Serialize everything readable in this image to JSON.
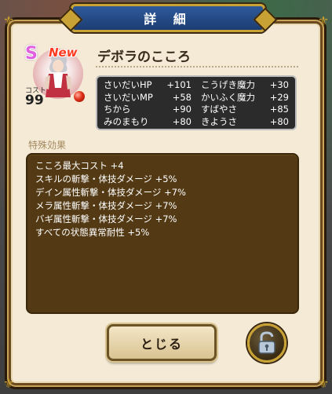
{
  "dialog": {
    "title": "詳 細"
  },
  "monster": {
    "rank": "S",
    "new_badge": "New",
    "cost_label": "コスト",
    "cost_value": "99",
    "heart_name": "デボラのこころ"
  },
  "stats": [
    {
      "label": "さいだいHP",
      "value": "+101"
    },
    {
      "label": "こうげき魔力",
      "value": "+30"
    },
    {
      "label": "さいだいMP",
      "value": "+58"
    },
    {
      "label": "かいふく魔力",
      "value": "+29"
    },
    {
      "label": "ちから",
      "value": "+90"
    },
    {
      "label": "すばやさ",
      "value": "+85"
    },
    {
      "label": "みのまもり",
      "value": "+80"
    },
    {
      "label": "きようさ",
      "value": "+80"
    }
  ],
  "special": {
    "label": "特殊効果",
    "effects": [
      "こころ最大コスト +4",
      "スキルの斬撃・体技ダメージ +5%",
      "デイン属性斬撃・体技ダメージ +7%",
      "メラ属性斬撃・体技ダメージ +7%",
      "バギ属性斬撃・体技ダメージ +7%",
      "すべての状態異常耐性 +5%"
    ]
  },
  "buttons": {
    "close_label": "とじる",
    "lock_icon": "unlocked-padlock-icon"
  },
  "colors": {
    "title_banner": "#1c3d73",
    "frame_gold": "#c9a235",
    "effects_bg": "#533a14",
    "stats_bg": "#2b2b2b",
    "rank_color": "#e060e0",
    "new_color": "#ff3a20"
  }
}
